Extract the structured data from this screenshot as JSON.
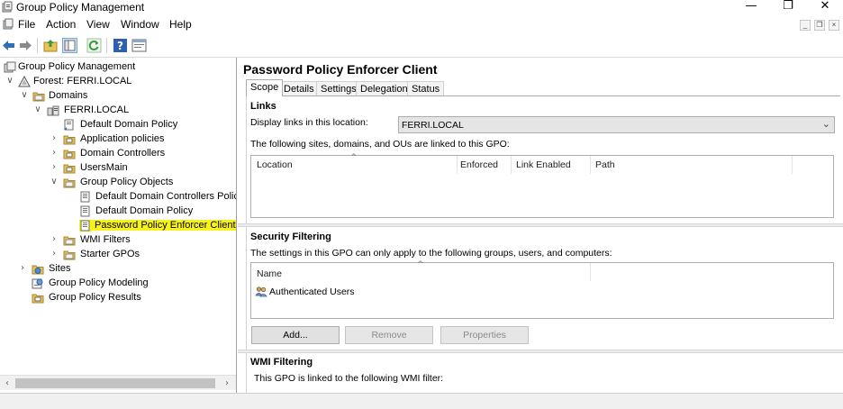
{
  "window": {
    "title": "Group Policy Management",
    "minimize_glyph": "—",
    "restore_glyph": "❐",
    "close_glyph": "✕"
  },
  "menubar": {
    "items": [
      "File",
      "Action",
      "View",
      "Window",
      "Help"
    ],
    "mdi_buttons": [
      "_",
      "❐",
      "×"
    ]
  },
  "toolbar": {
    "buttons": [
      "back-arrow-icon",
      "forward-arrow-icon",
      "up-folder-icon",
      "show-hide-tree-icon",
      "refresh-icon",
      "help-icon",
      "properties-icon"
    ]
  },
  "tree": {
    "nodes": [
      {
        "label": "Group Policy Management",
        "icon": "gpm-icon",
        "expander": "",
        "selected": false
      },
      {
        "label": "Forest: FERRI.LOCAL",
        "icon": "forest-icon",
        "expander": "∨",
        "selected": false
      },
      {
        "label": "Domains",
        "icon": "folder-icon",
        "expander": "∨",
        "selected": false
      },
      {
        "label": "FERRI.LOCAL",
        "icon": "domain-icon",
        "expander": "∨",
        "selected": false
      },
      {
        "label": "Default Domain Policy",
        "icon": "gpo-link-icon",
        "expander": "",
        "selected": false
      },
      {
        "label": "Application policies",
        "icon": "ou-icon",
        "expander": "›",
        "selected": false
      },
      {
        "label": "Domain Controllers",
        "icon": "ou-icon",
        "expander": "›",
        "selected": false
      },
      {
        "label": "UsersMain",
        "icon": "ou-icon",
        "expander": "›",
        "selected": false
      },
      {
        "label": "Group Policy Objects",
        "icon": "folder-icon",
        "expander": "∨",
        "selected": false
      },
      {
        "label": "Default Domain Controllers Polic",
        "icon": "gpo-icon",
        "expander": "",
        "selected": false
      },
      {
        "label": "Default Domain Policy",
        "icon": "gpo-icon",
        "expander": "",
        "selected": false
      },
      {
        "label": "Password Policy Enforcer Client",
        "icon": "gpo-icon",
        "expander": "",
        "selected": true
      },
      {
        "label": "WMI Filters",
        "icon": "folder-icon",
        "expander": "›",
        "selected": false
      },
      {
        "label": "Starter GPOs",
        "icon": "folder-icon",
        "expander": "›",
        "selected": false
      },
      {
        "label": "Sites",
        "icon": "sites-icon",
        "expander": "›",
        "selected": false
      },
      {
        "label": "Group Policy Modeling",
        "icon": "modeling-icon",
        "expander": "",
        "selected": false
      },
      {
        "label": "Group Policy Results",
        "icon": "results-icon",
        "expander": "",
        "selected": false
      }
    ],
    "scroll_left": "‹",
    "scroll_right": "›"
  },
  "details": {
    "title": "Password Policy Enforcer Client",
    "tabs": [
      "Scope",
      "Details",
      "Settings",
      "Delegation",
      "Status"
    ],
    "active_tab": "Scope",
    "links": {
      "heading": "Links",
      "display_label": "Display links in this location:",
      "location_value": "FERRI.LOCAL",
      "caret": "⌄",
      "linked_text": "The following sites, domains, and OUs are linked to this GPO:",
      "columns": [
        "Location",
        "Enforced",
        "Link Enabled",
        "Path"
      ],
      "rows": []
    },
    "security": {
      "heading": "Security Filtering",
      "description": "The settings in this GPO can only apply to the following groups, users, and computers:",
      "column": "Name",
      "entries": [
        "Authenticated Users"
      ],
      "buttons": {
        "add": "Add...",
        "remove": "Remove",
        "properties": "Properties"
      }
    },
    "wmi": {
      "heading": "WMI Filtering",
      "description": "This GPO is linked to the following WMI filter:"
    },
    "sort_caret": "^"
  },
  "colors": {
    "selection_highlight": "#f7f21a",
    "folder_yellow": "#e8c35a",
    "toolbar_blue": "#2f6fb8",
    "refresh_green": "#3a9b3a"
  }
}
